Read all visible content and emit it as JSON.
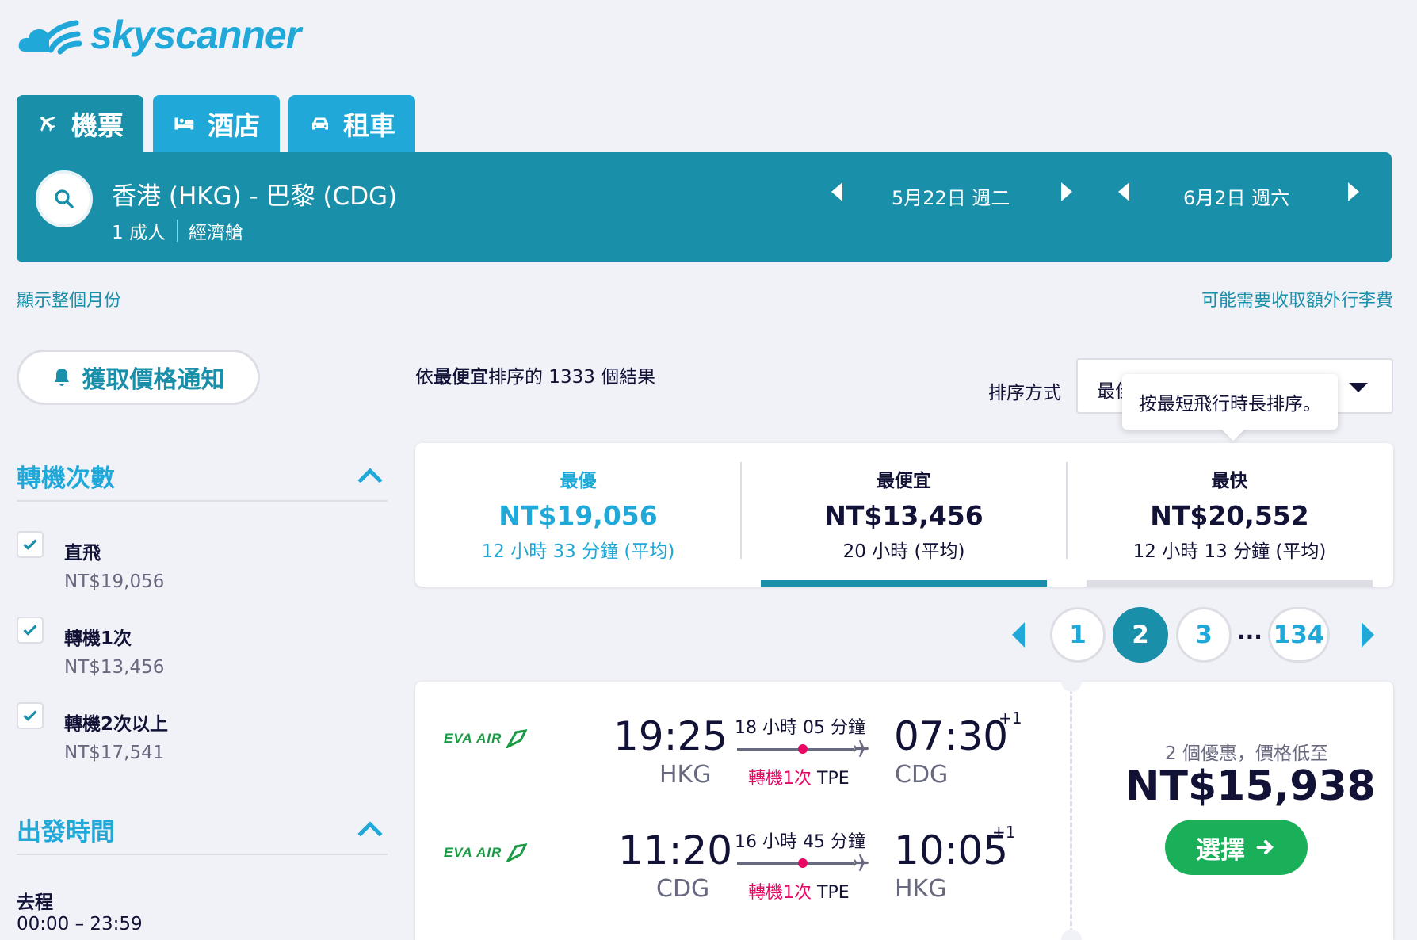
{
  "brand": {
    "name": "skyscanner",
    "color": "#1fa8d8"
  },
  "tabs": [
    {
      "label": "機票",
      "icon": "plane-icon",
      "active": true
    },
    {
      "label": "酒店",
      "icon": "bed-icon",
      "active": false
    },
    {
      "label": "租車",
      "icon": "car-icon",
      "active": false
    }
  ],
  "search": {
    "route": "香港 (HKG) - 巴黎 (CDG)",
    "passengers": "1 成人",
    "cabin": "經濟艙",
    "depart_date": "5月22日 週二",
    "return_date": "6月2日 週六"
  },
  "links": {
    "whole_month": "顯示整個月份",
    "baggage_fee": "可能需要收取額外行李費"
  },
  "price_alert": {
    "label": "獲取價格通知"
  },
  "filters": {
    "stops": {
      "title": "轉機次數",
      "options": [
        {
          "label": "直飛",
          "price": "NT$19,056",
          "checked": true
        },
        {
          "label": "轉機1次",
          "price": "NT$13,456",
          "checked": true
        },
        {
          "label": "轉機2次以上",
          "price": "NT$17,541",
          "checked": true
        }
      ]
    },
    "departure_time": {
      "title": "出發時間",
      "leg_label": "去程",
      "range": "00:00 – 23:59"
    }
  },
  "results": {
    "count_prefix": "依",
    "count_bold": "最便宜",
    "count_suffix": "排序的 1333 個結果",
    "sort_label": "排序方式",
    "sort_value": "最佳",
    "tooltip": "按最短飛行時長排序。"
  },
  "summary": [
    {
      "heading": "最優",
      "price": "NT$19,056",
      "duration": "12 小時 33 分鐘 (平均)",
      "highlight": true
    },
    {
      "heading": "最便宜",
      "price": "NT$13,456",
      "duration": "20 小時 (平均)",
      "highlight": false
    },
    {
      "heading": "最快",
      "price": "NT$20,552",
      "duration": "12 小時 13 分鐘 (平均)",
      "highlight": false
    }
  ],
  "pagination": {
    "pages": [
      "1",
      "2",
      "3"
    ],
    "ellipsis": "...",
    "last": "134",
    "current": "2"
  },
  "result_card": {
    "legs": [
      {
        "airline": "EVA AIR",
        "depart_time": "19:25",
        "depart_code": "HKG",
        "duration": "18 小時 05 分鐘",
        "stops_text": "轉機1次",
        "via": "TPE",
        "arrive_time": "07:30",
        "arrive_code": "CDG",
        "day_offset": "+1"
      },
      {
        "airline": "EVA AIR",
        "depart_time": "11:20",
        "depart_code": "CDG",
        "duration": "16 小時 45 分鐘",
        "stops_text": "轉機1次",
        "via": "TPE",
        "arrive_time": "10:05",
        "arrive_code": "HKG",
        "day_offset": "+1"
      }
    ],
    "deals_text": "2 個優惠，價格低至",
    "price": "NT$15,938",
    "select_label": "選擇"
  },
  "colors": {
    "primary": "#1a8fa9",
    "accent": "#1fa8d8",
    "stop": "#e70866",
    "select": "#1ab05a"
  }
}
